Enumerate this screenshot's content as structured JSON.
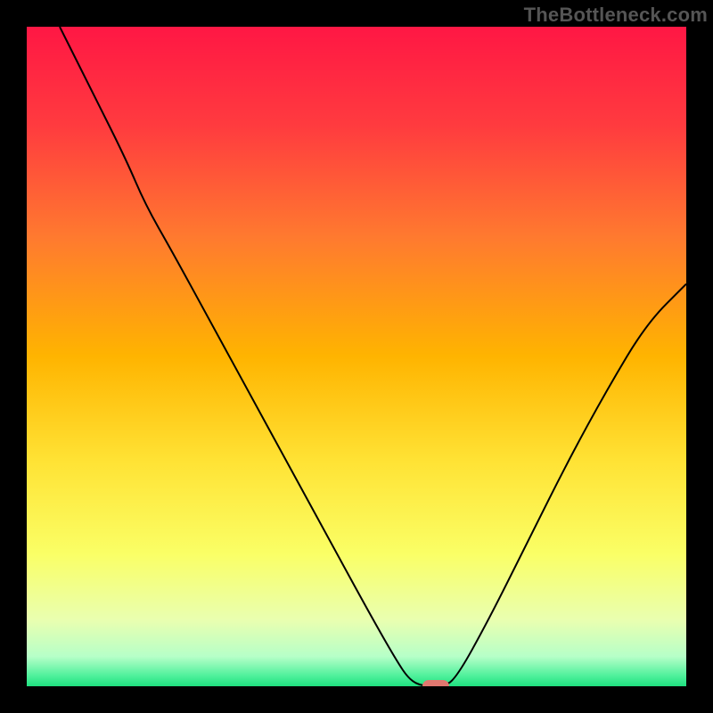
{
  "watermark": "TheBottleneck.com",
  "chart_data": {
    "type": "line",
    "title": "",
    "xlabel": "",
    "ylabel": "",
    "xlim": [
      0,
      100
    ],
    "ylim": [
      0,
      100
    ],
    "grid": false,
    "legend": false,
    "background": {
      "stops": [
        {
          "pos": 0.0,
          "color": "#ff1744"
        },
        {
          "pos": 0.15,
          "color": "#ff3b3f"
        },
        {
          "pos": 0.32,
          "color": "#ff7a2f"
        },
        {
          "pos": 0.5,
          "color": "#ffb400"
        },
        {
          "pos": 0.66,
          "color": "#ffe335"
        },
        {
          "pos": 0.8,
          "color": "#faff66"
        },
        {
          "pos": 0.9,
          "color": "#e9ffb0"
        },
        {
          "pos": 0.955,
          "color": "#b6ffc8"
        },
        {
          "pos": 0.985,
          "color": "#4cf09a"
        },
        {
          "pos": 1.0,
          "color": "#1fe07f"
        }
      ]
    },
    "series": [
      {
        "name": "bottleneck-curve",
        "color": "#000000",
        "width": 2,
        "points": [
          {
            "x": 5,
            "y": 100
          },
          {
            "x": 10,
            "y": 90
          },
          {
            "x": 15,
            "y": 80
          },
          {
            "x": 18,
            "y": 73
          },
          {
            "x": 22,
            "y": 66
          },
          {
            "x": 28,
            "y": 55
          },
          {
            "x": 34,
            "y": 44
          },
          {
            "x": 40,
            "y": 33
          },
          {
            "x": 46,
            "y": 22
          },
          {
            "x": 52,
            "y": 11
          },
          {
            "x": 56,
            "y": 4
          },
          {
            "x": 58,
            "y": 1
          },
          {
            "x": 60,
            "y": 0
          },
          {
            "x": 63,
            "y": 0
          },
          {
            "x": 65,
            "y": 1
          },
          {
            "x": 70,
            "y": 10
          },
          {
            "x": 76,
            "y": 22
          },
          {
            "x": 82,
            "y": 34
          },
          {
            "x": 88,
            "y": 45
          },
          {
            "x": 94,
            "y": 55
          },
          {
            "x": 100,
            "y": 61
          }
        ]
      }
    ],
    "marker": {
      "x": 62,
      "y": 0,
      "color": "#e0776f"
    }
  }
}
